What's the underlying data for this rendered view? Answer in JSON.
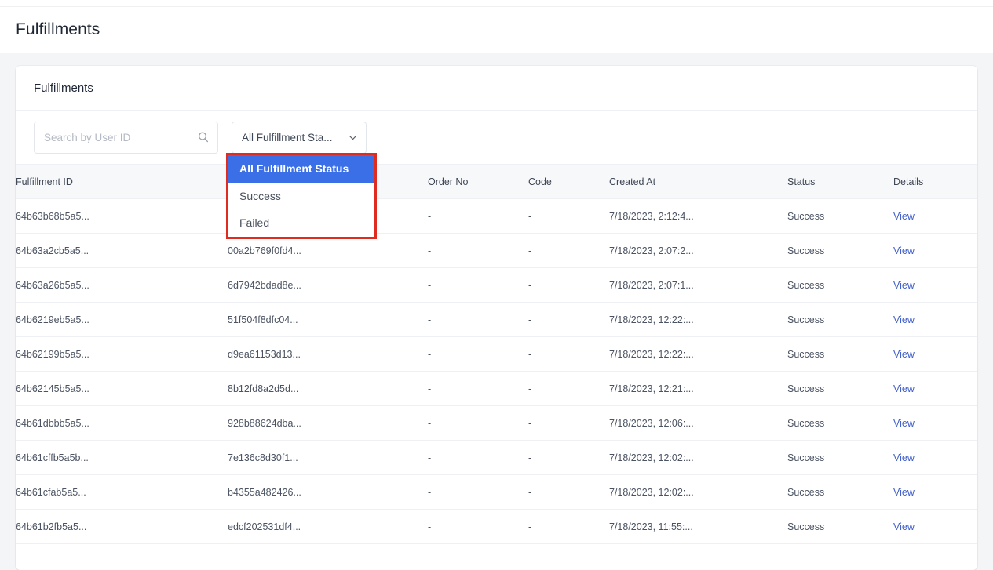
{
  "page": {
    "title": "Fulfillments"
  },
  "card": {
    "title": "Fulfillments"
  },
  "search": {
    "placeholder": "Search by User ID",
    "value": "",
    "icon": "search-icon"
  },
  "status_filter": {
    "selected_label": "All Fulfillment Sta...",
    "chevron_icon": "chevron-down-icon",
    "open": true,
    "options": [
      {
        "label": "All Fulfillment Status",
        "selected": true
      },
      {
        "label": "Success",
        "selected": false
      },
      {
        "label": "Failed",
        "selected": false
      }
    ],
    "highlight_color": "#e02b20",
    "selected_bg_color": "#3b6fe8"
  },
  "table": {
    "columns": [
      {
        "key": "fulfillment_id",
        "label": "Fulfillment ID"
      },
      {
        "key": "hash",
        "label": ""
      },
      {
        "key": "order_no",
        "label": "Order No"
      },
      {
        "key": "code",
        "label": "Code"
      },
      {
        "key": "created_at",
        "label": "Created At"
      },
      {
        "key": "status",
        "label": "Status"
      },
      {
        "key": "details",
        "label": "Details"
      }
    ],
    "rows": [
      {
        "fulfillment_id": "64b63b68b5a5...",
        "hash": "",
        "order_no": "-",
        "code": "-",
        "created_at": "7/18/2023, 2:12:4...",
        "status": "Success",
        "details": "View"
      },
      {
        "fulfillment_id": "64b63a2cb5a5...",
        "hash": "00a2b769f0fd4...",
        "order_no": "-",
        "code": "-",
        "created_at": "7/18/2023, 2:07:2...",
        "status": "Success",
        "details": "View"
      },
      {
        "fulfillment_id": "64b63a26b5a5...",
        "hash": "6d7942bdad8e...",
        "order_no": "-",
        "code": "-",
        "created_at": "7/18/2023, 2:07:1...",
        "status": "Success",
        "details": "View"
      },
      {
        "fulfillment_id": "64b6219eb5a5...",
        "hash": "51f504f8dfc04...",
        "order_no": "-",
        "code": "-",
        "created_at": "7/18/2023, 12:22:...",
        "status": "Success",
        "details": "View"
      },
      {
        "fulfillment_id": "64b62199b5a5...",
        "hash": "d9ea61153d13...",
        "order_no": "-",
        "code": "-",
        "created_at": "7/18/2023, 12:22:...",
        "status": "Success",
        "details": "View"
      },
      {
        "fulfillment_id": "64b62145b5a5...",
        "hash": "8b12fd8a2d5d...",
        "order_no": "-",
        "code": "-",
        "created_at": "7/18/2023, 12:21:...",
        "status": "Success",
        "details": "View"
      },
      {
        "fulfillment_id": "64b61dbbb5a5...",
        "hash": "928b88624dba...",
        "order_no": "-",
        "code": "-",
        "created_at": "7/18/2023, 12:06:...",
        "status": "Success",
        "details": "View"
      },
      {
        "fulfillment_id": "64b61cffb5a5b...",
        "hash": "7e136c8d30f1...",
        "order_no": "-",
        "code": "-",
        "created_at": "7/18/2023, 12:02:...",
        "status": "Success",
        "details": "View"
      },
      {
        "fulfillment_id": "64b61cfab5a5...",
        "hash": "b4355a482426...",
        "order_no": "-",
        "code": "-",
        "created_at": "7/18/2023, 12:02:...",
        "status": "Success",
        "details": "View"
      },
      {
        "fulfillment_id": "64b61b2fb5a5...",
        "hash": "edcf202531df4...",
        "order_no": "-",
        "code": "-",
        "created_at": "7/18/2023, 11:55:...",
        "status": "Success",
        "details": "View"
      }
    ]
  }
}
